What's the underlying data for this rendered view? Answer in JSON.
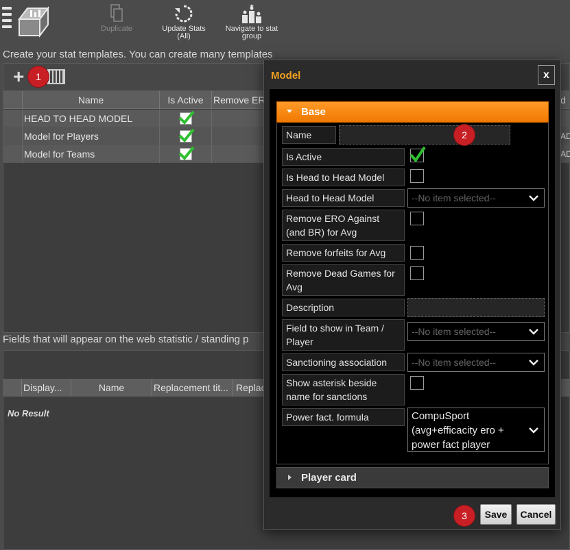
{
  "toolbar": {
    "duplicate_label": "Duplicate",
    "update_stats_label": "Update Stats",
    "update_stats_sub": "(All)",
    "navigate_label": "Navigate to stat",
    "navigate_sub": "group"
  },
  "heading": "Create your stat templates. You can create many templates",
  "badges": {
    "one": "1",
    "two": "2",
    "three": "3"
  },
  "grid": {
    "columns": [
      "Name",
      "Is Active",
      "Remove ERO",
      "d"
    ],
    "rows": [
      {
        "name": "HEAD TO HEAD MODEL",
        "is_active": true,
        "tail": ""
      },
      {
        "name": "Model for Players",
        "is_active": true,
        "tail": "AD"
      },
      {
        "name": "Model for Teams",
        "is_active": true,
        "tail": "AD"
      }
    ]
  },
  "subheading": "Fields that will appear on the web statistic / standing p",
  "grid2": {
    "columns": [
      "Display...",
      "Name",
      "Replacement tit...",
      "Replac"
    ],
    "empty_text": "No Result"
  },
  "modal": {
    "title": "Model",
    "close_label": "x",
    "section_base": "Base",
    "section_player_card": "Player card",
    "fields": {
      "name_label": "Name",
      "is_active_label": "Is Active",
      "is_h2h_label": "Is Head to Head Model",
      "h2h_model_label": "Head to Head Model",
      "h2h_model_value": "--No item selected--",
      "remove_ero_label": "Remove ERO Against (and BR) for Avg",
      "remove_forfeits_label": "Remove forfeits for Avg",
      "remove_dead_label": "Remove Dead Games for Avg",
      "description_label": "Description",
      "field_team_label": "Field to show in Team / Player",
      "field_team_value": "--No item selected--",
      "sanction_label": "Sanctioning association",
      "sanction_value": "--No item selected--",
      "asterisk_label": "Show asterisk beside name for sanctions",
      "power_label": "Power fact. formula",
      "power_value": "CompuSport (avg+efficacity ero + power fact player"
    },
    "values": {
      "is_active": true,
      "is_h2h": false,
      "remove_ero": false,
      "remove_forfeits": false,
      "remove_dead": false,
      "asterisk": false
    },
    "save_label": "Save",
    "cancel_label": "Cancel"
  },
  "colors": {
    "accent": "#f07800",
    "title": "#f0a020",
    "badge": "#c81f25",
    "check": "#2fbf2f"
  }
}
